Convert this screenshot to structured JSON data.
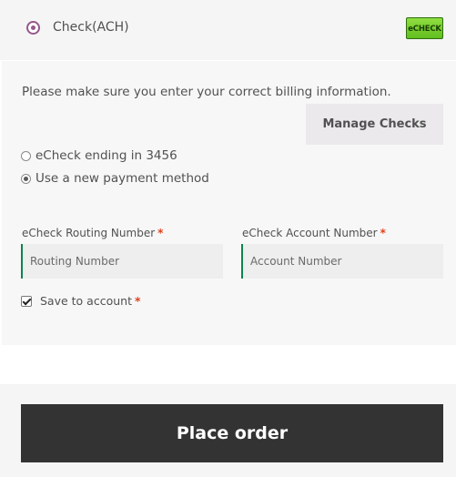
{
  "payment_method": {
    "label": "Check(ACH)",
    "logo_text": "eCHECK",
    "selected": true
  },
  "payment_box": {
    "info_text": "Please make sure you enter your correct billing information.",
    "manage_button": "Manage Checks",
    "options": [
      {
        "label": "eCheck ending in 3456",
        "checked": false
      },
      {
        "label": "Use a new payment method",
        "checked": true
      }
    ],
    "fields": {
      "routing": {
        "label": "eCheck Routing Number",
        "required_mark": "*",
        "placeholder": "Routing Number",
        "value": ""
      },
      "account": {
        "label": "eCheck Account Number",
        "required_mark": "*",
        "placeholder": "Account Number",
        "value": ""
      }
    },
    "save_to_account": {
      "label": "Save to account",
      "required_mark": "*",
      "checked": true
    }
  },
  "place_order_label": "Place order",
  "colors": {
    "accent": "#96588a",
    "field_border": "#0f834d",
    "required": "#e2401c",
    "button_dark": "#333333",
    "button_light": "#ebe9eb",
    "logo_green": "#7bd03a"
  },
  "icons": [
    "radio-selected-icon",
    "echeck-logo",
    "checkbox-checked-icon"
  ]
}
